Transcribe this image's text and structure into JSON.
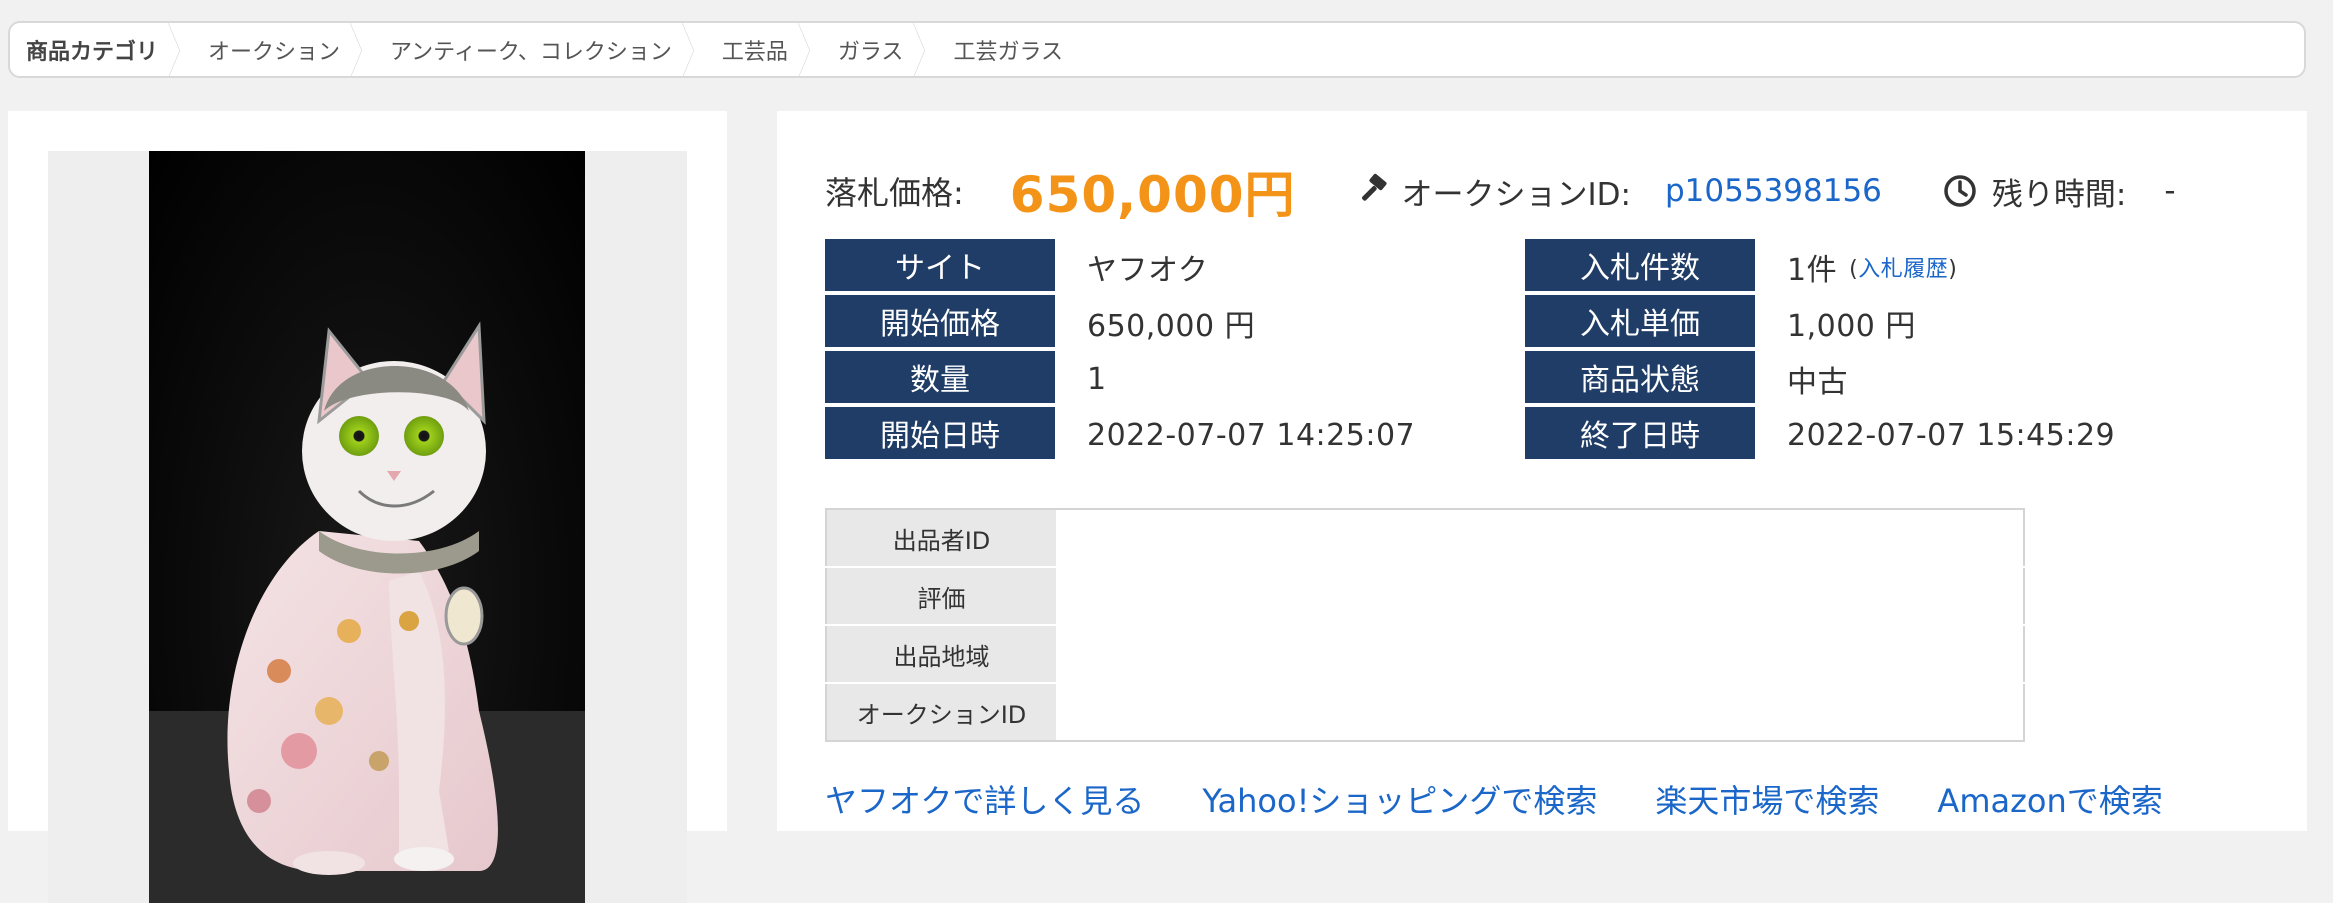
{
  "breadcrumb": [
    "商品カテゴリ",
    "オークション",
    "アンティーク、コレクション",
    "工芸品",
    "ガラス",
    "工芸ガラス"
  ],
  "price": {
    "label": "落札価格:",
    "value": "650,000円"
  },
  "auction_id": {
    "label": "オークションID:",
    "value": "p1055398156"
  },
  "remaining": {
    "label": "残り時間:",
    "value": "-"
  },
  "specs": {
    "left": [
      {
        "head": "サイト",
        "value": "ヤフオク"
      },
      {
        "head": "開始価格",
        "value": "650,000 円"
      },
      {
        "head": "数量",
        "value": "1"
      },
      {
        "head": "開始日時",
        "value": "2022-07-07 14:25:07"
      }
    ],
    "right": [
      {
        "head": "入札件数",
        "value": "1件",
        "link_paren_open": "(",
        "link": "入札履歴",
        "link_paren_close": ")"
      },
      {
        "head": "入札単価",
        "value": "1,000 円"
      },
      {
        "head": "商品状態",
        "value": "中古"
      },
      {
        "head": "終了日時",
        "value": "2022-07-07 15:45:29"
      }
    ]
  },
  "seller": {
    "rows": [
      "出品者ID",
      "評価",
      "出品地域",
      "オークションID"
    ]
  },
  "links": [
    "ヤフオクで詳しく見る",
    "Yahoo!ショッピングで検索",
    "楽天市場で検索",
    "Amazonで検索"
  ],
  "colors": {
    "accent_price": "#f39419",
    "link": "#1a66c9",
    "header_bg": "#1f3d66"
  },
  "icons": {
    "auction": "gavel-icon",
    "time": "clock-icon"
  }
}
